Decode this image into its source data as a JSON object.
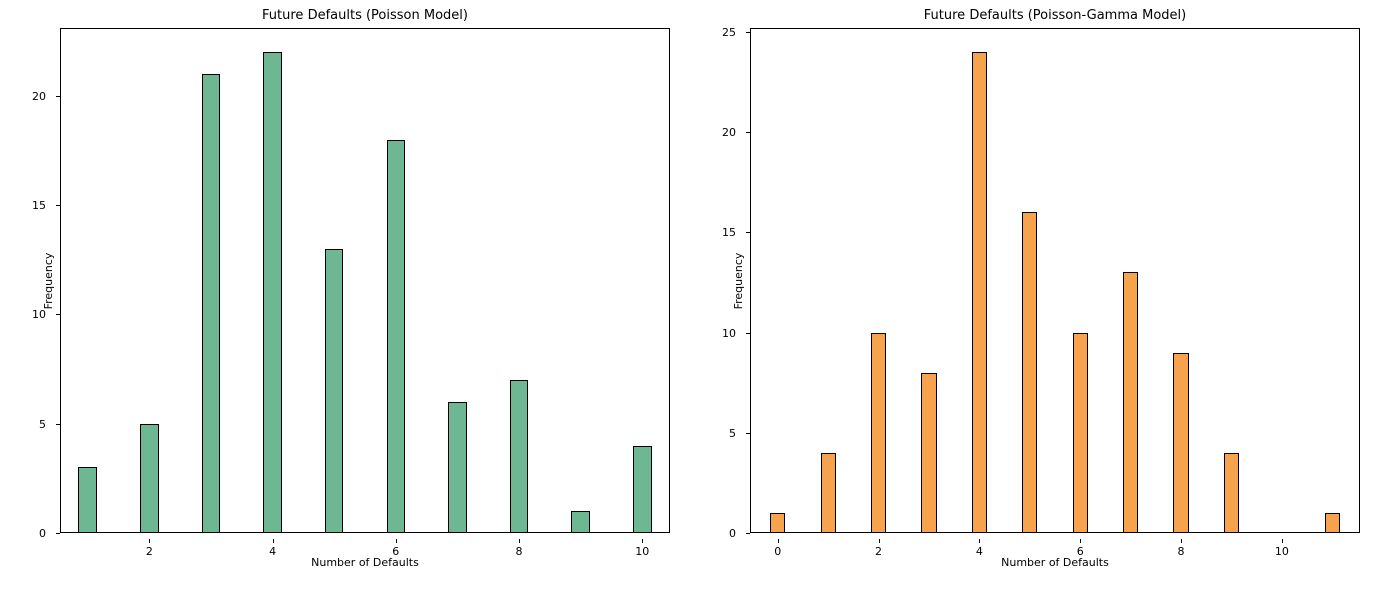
{
  "chart_data": [
    {
      "type": "bar",
      "title": "Future Defaults (Poisson Model)",
      "xlabel": "Number of Defaults",
      "ylabel": "Frequency",
      "color": "#6db793",
      "xlim": [
        0.55,
        10.45
      ],
      "ylim": [
        0,
        23.1
      ],
      "xticks": [
        2,
        4,
        6,
        8,
        10
      ],
      "yticks": [
        0,
        5,
        10,
        15,
        20
      ],
      "bar_width": 0.3,
      "categories": [
        1,
        2,
        3,
        4,
        5,
        6,
        7,
        8,
        9,
        10
      ],
      "values": [
        3,
        5,
        21,
        22,
        13,
        18,
        6,
        7,
        1,
        4
      ]
    },
    {
      "type": "bar",
      "title": "Future Defaults (Poisson-Gamma Model)",
      "xlabel": "Number of Defaults",
      "ylabel": "Frequency",
      "color": "#f7a24d",
      "xlim": [
        -0.55,
        11.55
      ],
      "ylim": [
        0,
        25.2
      ],
      "xticks": [
        0,
        2,
        4,
        6,
        8,
        10
      ],
      "yticks": [
        0,
        5,
        10,
        15,
        20,
        25
      ],
      "bar_width": 0.3,
      "categories": [
        0,
        1,
        2,
        3,
        4,
        5,
        6,
        7,
        8,
        9,
        11
      ],
      "values": [
        1,
        4,
        10,
        8,
        24,
        16,
        10,
        13,
        9,
        4,
        1
      ]
    }
  ]
}
